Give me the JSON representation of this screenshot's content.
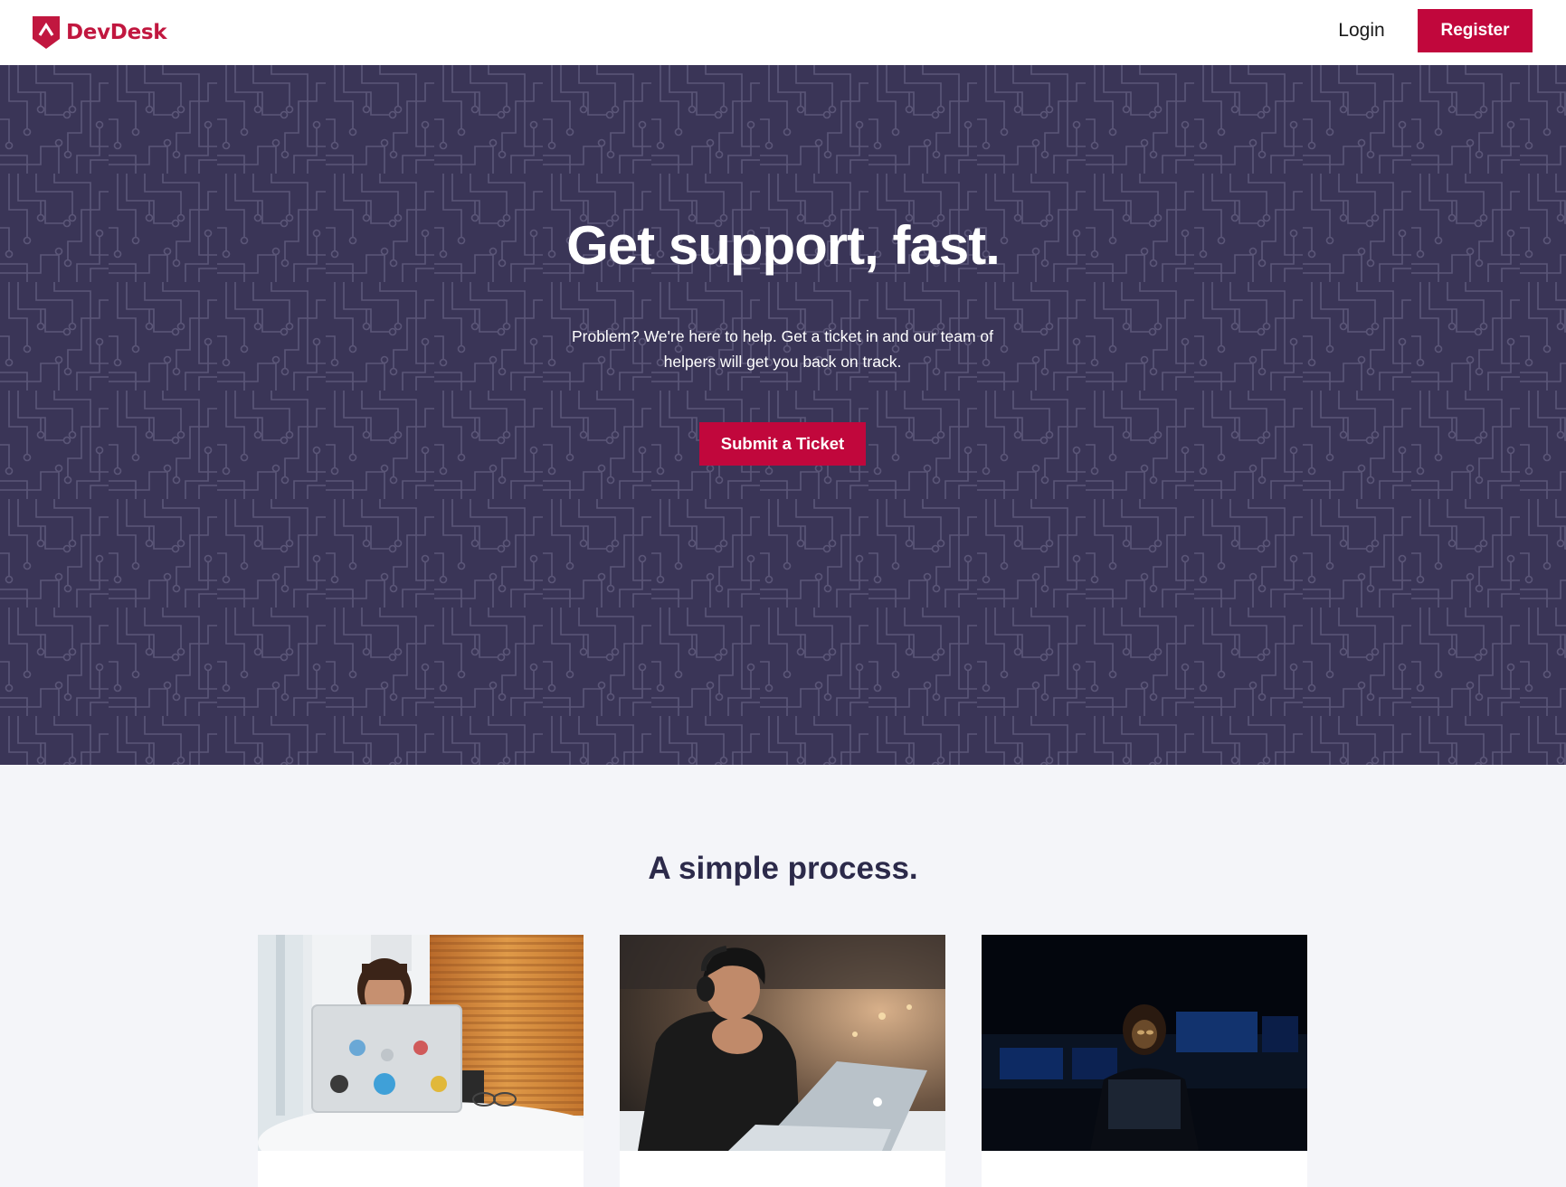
{
  "header": {
    "brand": "DevDesk",
    "login_label": "Login",
    "register_label": "Register"
  },
  "hero": {
    "title": "Get support, fast.",
    "subtitle": "Problem? We're here to help. Get a ticket in and our team of helpers will get you back on track.",
    "cta_label": "Submit a Ticket"
  },
  "process": {
    "title": "A simple process.",
    "cards": [
      {
        "image": "woman-with-laptop-stickers-photo"
      },
      {
        "image": "man-with-headphones-laptop-photo"
      },
      {
        "image": "person-laptop-dark-room-photo"
      }
    ]
  },
  "colors": {
    "brand_red": "#c1073c",
    "hero_background": "#3a3557",
    "page_background": "#f4f5f9",
    "heading_dark": "#2c2a4a"
  }
}
